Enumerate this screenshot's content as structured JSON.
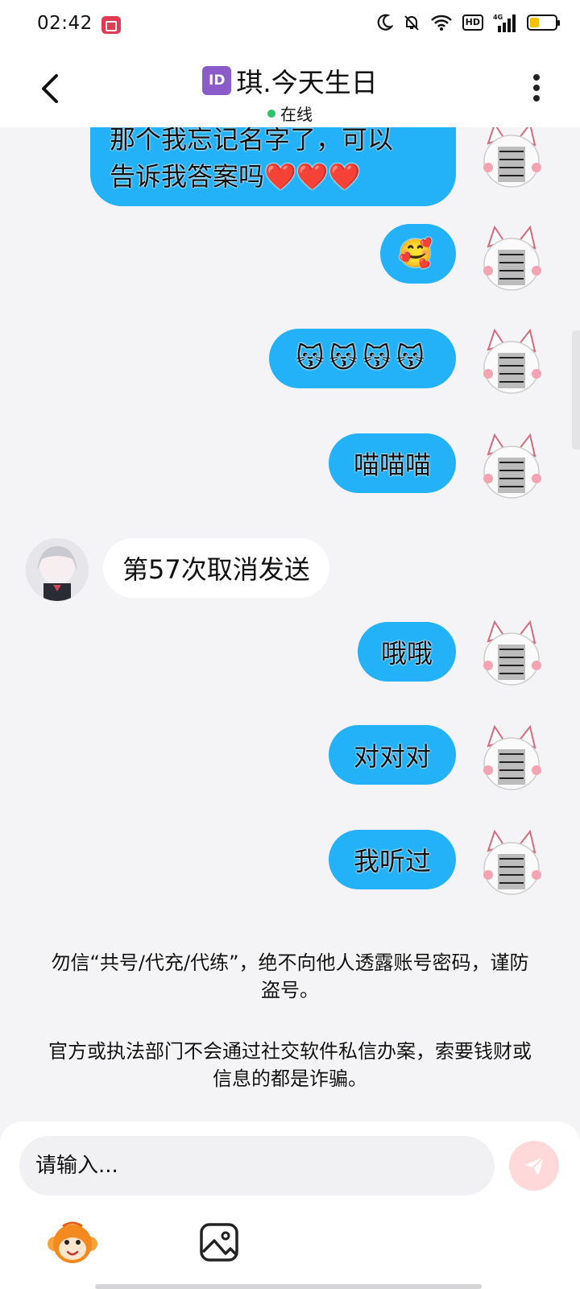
{
  "status_bar": {
    "time": "02:42",
    "hd_label": "HD",
    "network_label": "4G",
    "icons": [
      "recording-icon",
      "moon-icon",
      "mute-bell-icon",
      "wifi-icon",
      "hd-icon",
      "signal-icon",
      "battery-icon"
    ]
  },
  "header": {
    "id_badge": "ID",
    "title": "琪.今天生日",
    "status": "在线",
    "status_color": "#2ac36a"
  },
  "messages": [
    {
      "side": "right",
      "text_line1": "那个我忘记名字了，可以",
      "text_line2": "告诉我答案吗❤️❤️❤️"
    },
    {
      "side": "right",
      "text": "🥰"
    },
    {
      "side": "right",
      "text": "😽😽😽😽"
    },
    {
      "side": "right",
      "text": "喵喵喵"
    },
    {
      "side": "left",
      "text": "第57次取消发送"
    },
    {
      "side": "right",
      "text": "哦哦"
    },
    {
      "side": "right",
      "text": "对对对"
    },
    {
      "side": "right",
      "text": "我听过"
    }
  ],
  "notices": {
    "line1": "勿信“共号/代充/代练”，绝不向他人透露账号密码，谨防盗号。",
    "line2": "官方或执法部门不会通过社交软件私信办案，索要钱财或信息的都是诈骗。"
  },
  "input": {
    "placeholder": "请输入..."
  },
  "colors": {
    "bubble_out": "#23b1f7",
    "bubble_in": "#ffffff",
    "send_button": "#ffd9d9",
    "background": "#f4f4f6"
  }
}
